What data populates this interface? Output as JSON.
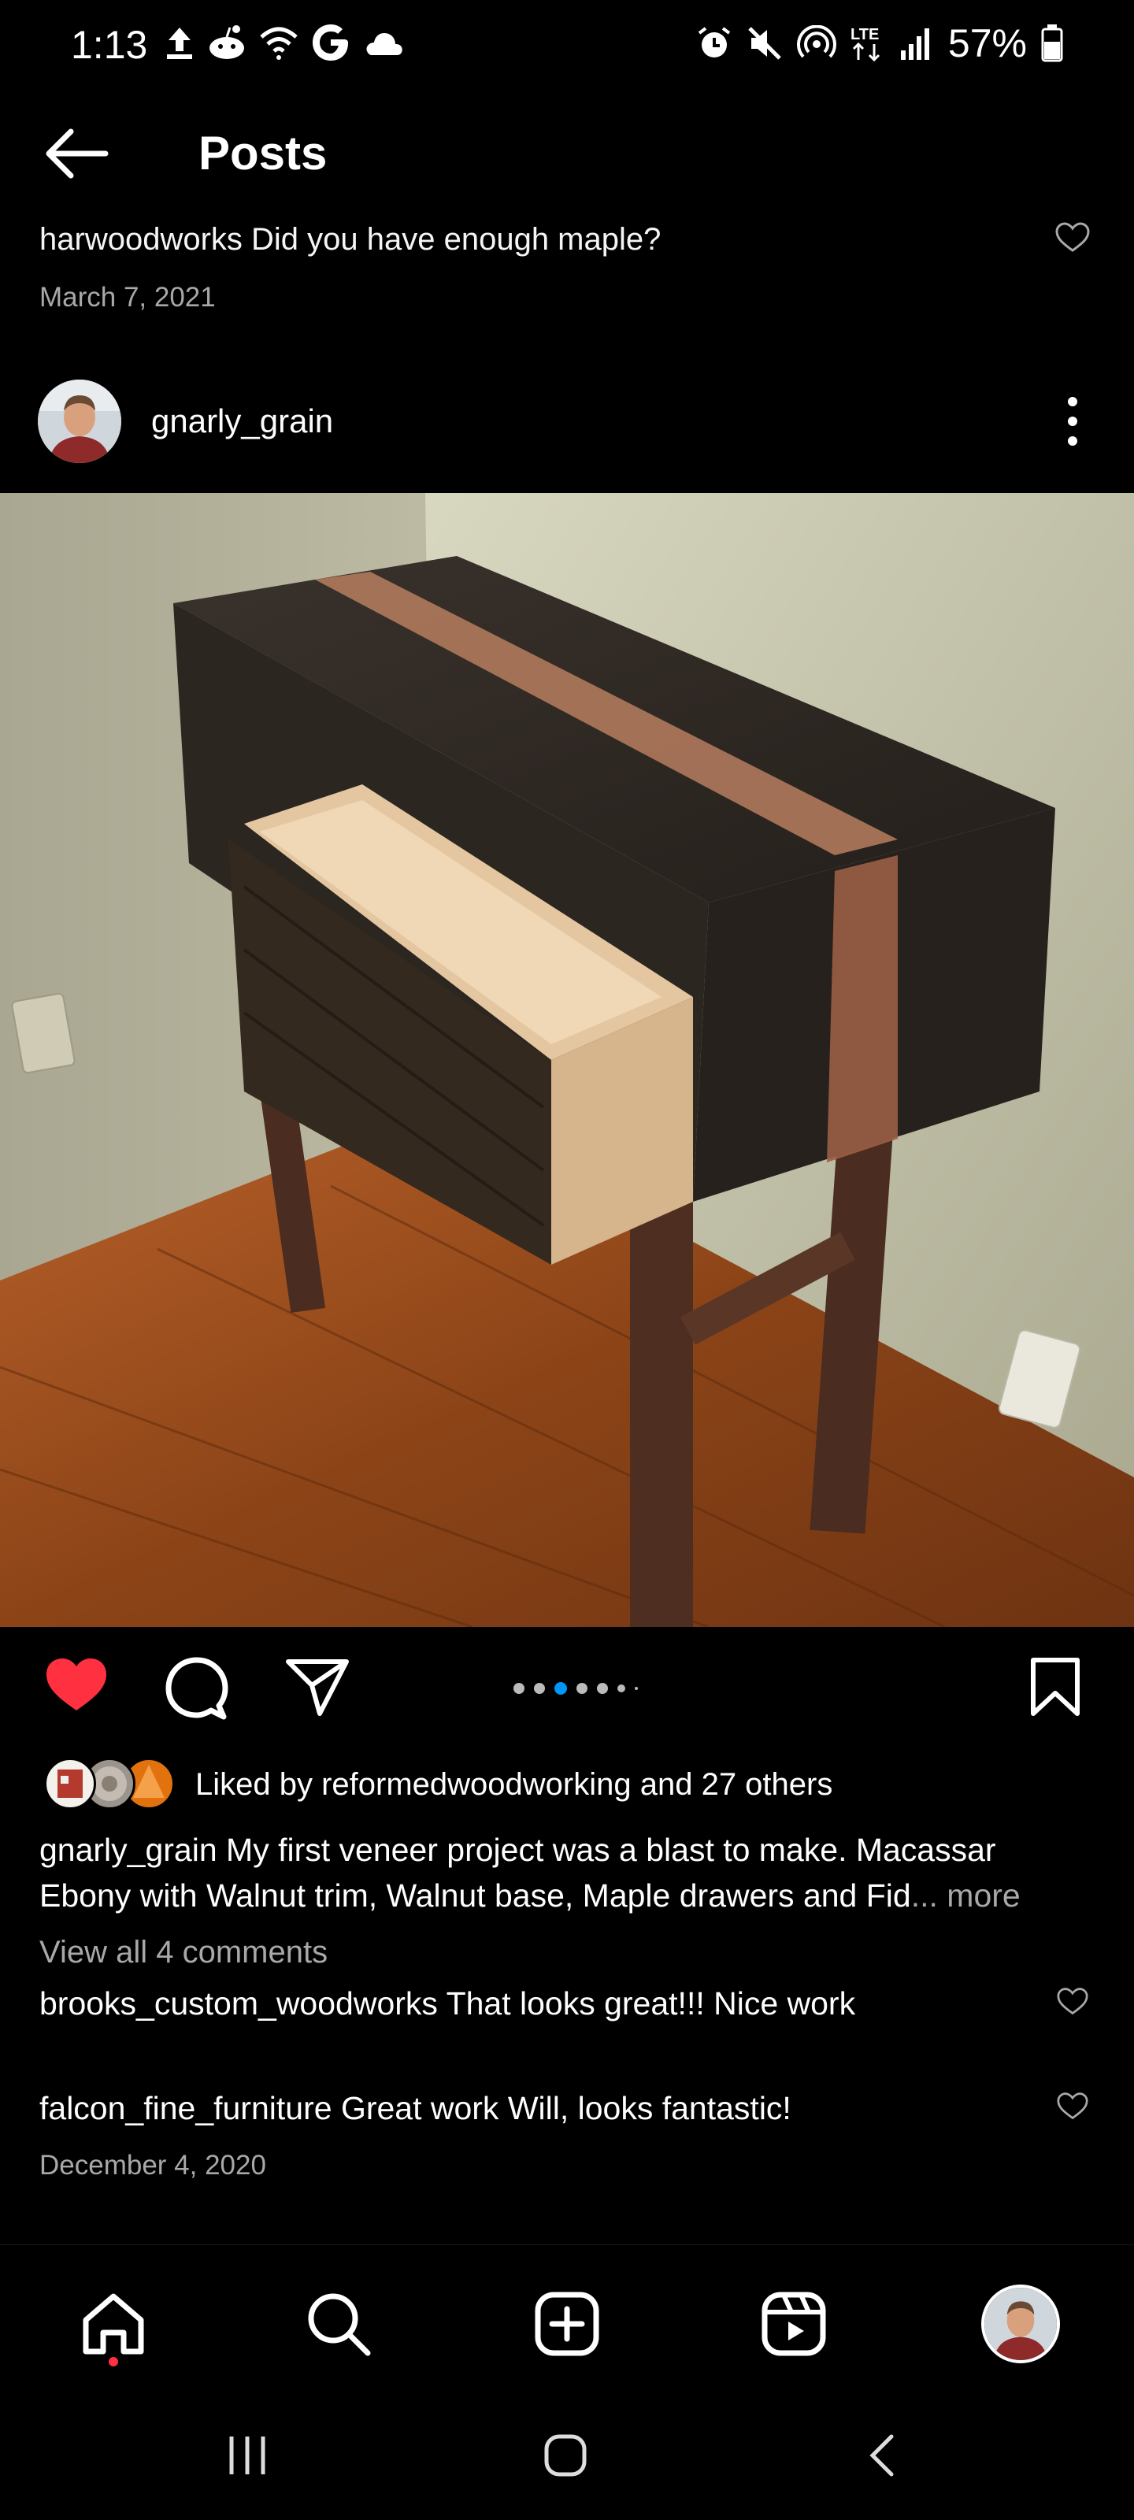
{
  "status_bar": {
    "time": "1:13",
    "battery": "57%",
    "network": "LTE",
    "left_icons": [
      "upload-icon",
      "reddit-icon",
      "wifi-question-icon",
      "google-icon",
      "cloud-icon"
    ],
    "right_icons": [
      "alarm-icon",
      "mute-icon",
      "hotspot-icon",
      "lte-icon",
      "signal-icon",
      "battery-icon"
    ]
  },
  "header": {
    "title": "Posts"
  },
  "previous_post": {
    "comment": "harwoodworks Did you have enough maple?",
    "date": "March 7, 2021"
  },
  "post": {
    "username": "gnarly_grain",
    "likes_text": "Liked by reformedwoodworking and 27 others",
    "caption_username": "gnarly_grain",
    "caption_text": "My first veneer project was a blast to make. Macassar Ebony with Walnut trim, Walnut base, Maple drawers and Fid",
    "caption_ellipsis": "...",
    "more_label": "more",
    "view_comments": "View all 4 comments",
    "comments": [
      {
        "user": "brooks_custom_woodworks",
        "text": "That looks great!!! Nice work"
      },
      {
        "user": "falcon_fine_furniture",
        "text": "Great work Will, looks fantastic!"
      }
    ],
    "date": "December 4, 2020",
    "liked": true,
    "carousel_count": 7,
    "carousel_active": 2
  },
  "bottom_nav": {
    "items": [
      "home-icon",
      "search-icon",
      "create-icon",
      "reels-icon",
      "profile-avatar"
    ]
  },
  "colors": {
    "background": "#000000",
    "like_red": "#ff3040",
    "accent_blue": "#0095f6",
    "secondary_text": "#a8a8a8"
  }
}
